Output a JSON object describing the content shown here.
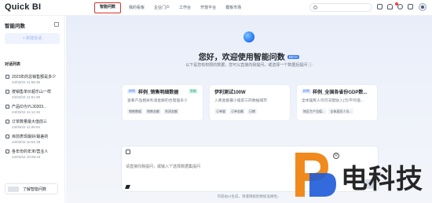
{
  "app": {
    "logo": "Quick BI"
  },
  "nav": {
    "items": [
      {
        "label": "智能问数"
      },
      {
        "label": "我的看板"
      },
      {
        "label": "企业门户"
      },
      {
        "label": "工作台"
      },
      {
        "label": "开放平台"
      },
      {
        "label": "模板市场"
      }
    ]
  },
  "sidebar": {
    "title": "智能问数",
    "new_chat": "+ 新建会话",
    "section_title": "对话列表",
    "conversations": [
      {
        "title": "2023年的总销售额是多少",
        "time": "24/03/22 11:55:35"
      },
      {
        "title": "按销售单价超乐山一样",
        "time": "24/03/22 11:51:39"
      },
      {
        "title": "产品ID为YL30303...",
        "time": "24/03/22 11:12:15"
      },
      {
        "title": "订单数量最大值前三",
        "time": "24/03/22 11:05:54"
      },
      {
        "title": "目前表现最好/最差的",
        "time": "24/03/22 10:51:38"
      },
      {
        "title": "各年份的年末/营业人",
        "time": "24/03/22 10:05:44"
      }
    ],
    "learn_label": "了解智能问数"
  },
  "main": {
    "welcome": "您好，欢迎使用智能问数",
    "beta": "BETA",
    "subtitle": "以下是您有权限的数据，您可以直接向我提问，或选择一个数据后提问 ⓘ",
    "cards": [
      {
        "tag": "样例",
        "title": "样例_销售明细数据",
        "badge": "智能",
        "desc": "查看产品相关利润金额的合理值多少",
        "chips": [
          "销售数据",
          "销售金额",
          "利润金额"
        ]
      },
      {
        "tag": "",
        "title": "伊利测试100W",
        "badge": "",
        "desc": "入库金额最小值前三的数据城市",
        "chips": [
          "订单量",
          "订单金额",
          "日期"
        ]
      },
      {
        "tag": "样例",
        "title": "样例_全国各省份GDP数...",
        "badge": "",
        "desc": "全体居民人均可支配收入(元/平均值...",
        "chips": [
          "地区生产总值...",
          "全体居民人均..."
        ]
      }
    ],
    "composer": {
      "placeholder": "请直接向我提问，或输入\"/\"选择数据集提问"
    },
    "disclaimer": "内容由AI生成，请谨慎甄别数据准确性。"
  },
  "watermark": {
    "text": "电科技"
  },
  "colors": {
    "accent": "#2f6fe8",
    "highlight": "#e0302a",
    "watermark_blue": "#1e5bd8",
    "watermark_orange": "#f08a1c"
  }
}
